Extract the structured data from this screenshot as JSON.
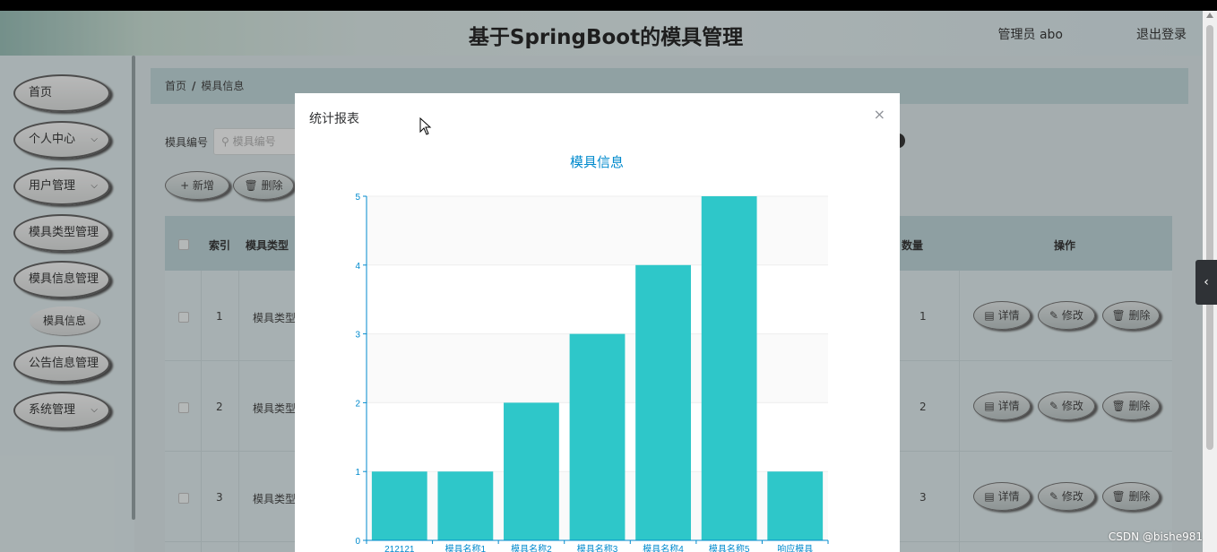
{
  "header": {
    "title": "基于SpringBoot的模具管理",
    "user": "管理员 abo",
    "logout": "退出登录"
  },
  "sidebar": {
    "items": [
      {
        "label": "首页",
        "chevron": false
      },
      {
        "label": "个人中心",
        "chevron": true
      },
      {
        "label": "用户管理",
        "chevron": true
      },
      {
        "label": "模具类型管理",
        "chevron": false
      },
      {
        "label": "模具信息管理",
        "chevron": false
      },
      {
        "label": "公告信息管理",
        "chevron": false
      },
      {
        "label": "系统管理",
        "chevron": true
      }
    ],
    "sub_item": "模具信息"
  },
  "breadcrumb": {
    "home": "首页",
    "sep": "/",
    "current": "模具信息"
  },
  "search": {
    "label": "模具编号",
    "placeholder": "模具编号"
  },
  "toolbar": {
    "add": "+ 新增",
    "delete": "删除"
  },
  "table": {
    "headers": {
      "index": "索引",
      "type": "模具类型",
      "qty": "数量",
      "ops": "操作"
    },
    "rows": [
      {
        "index": "1",
        "type": "模具类型",
        "qty": "1"
      },
      {
        "index": "2",
        "type": "模具类型",
        "qty": "2"
      },
      {
        "index": "3",
        "type": "模具类型",
        "qty": "3"
      }
    ],
    "actions": {
      "detail": "详情",
      "edit": "修改",
      "delete": "删除"
    }
  },
  "dialog": {
    "title": "统计报表",
    "close": "×"
  },
  "chart_data": {
    "type": "bar",
    "title": "模具信息",
    "categories": [
      "212121",
      "模具名称1",
      "模具名称2",
      "模具名称3",
      "模具名称4",
      "模具名称5",
      "响应模具"
    ],
    "values": [
      1,
      1,
      2,
      3,
      4,
      5,
      1
    ],
    "ylim": [
      0,
      5
    ],
    "yticks": [
      0,
      1,
      2,
      3,
      4,
      5
    ],
    "bar_color": "#2ec7c9",
    "axis_color": "#008acd",
    "grid": true
  },
  "watermark": "CSDN @bishe981",
  "edge_button": "‹"
}
